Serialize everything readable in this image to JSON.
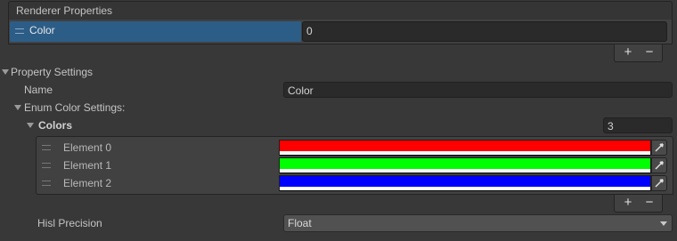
{
  "renderer_properties": {
    "header": "Renderer Properties",
    "items": [
      {
        "label": "Color",
        "value": "0"
      }
    ],
    "add_label": "+",
    "remove_label": "−"
  },
  "property_settings": {
    "title": "Property Settings",
    "name_label": "Name",
    "name_value": "Color",
    "enum_color_settings": {
      "title": "Enum Color Settings:",
      "colors": {
        "title": "Colors",
        "count": "3",
        "elements": [
          {
            "label": "Element 0",
            "color": "#ff0000"
          },
          {
            "label": "Element 1",
            "color": "#00ff00"
          },
          {
            "label": "Element 2",
            "color": "#0000ff"
          }
        ],
        "add_label": "+",
        "remove_label": "−"
      }
    },
    "hsl_precision_label": "Hisl Precision",
    "hsl_precision_value": "Float"
  },
  "icons": {
    "foldout": "triangle-down-icon",
    "drag": "drag-handle-icon",
    "picker": "eyedropper-icon",
    "dropdown": "chevron-down-icon"
  }
}
